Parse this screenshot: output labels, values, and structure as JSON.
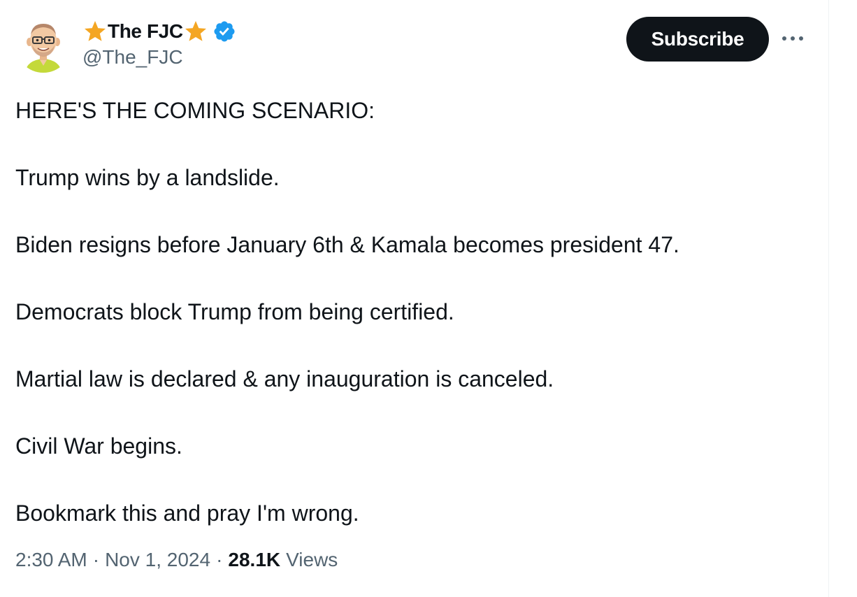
{
  "author": {
    "display_name": "The FJC",
    "handle": "@The_FJC",
    "name_decoration_icon": "star-icon",
    "verified_icon": "verified-badge-icon",
    "verified_color": "#1d9bf0"
  },
  "actions": {
    "subscribe_label": "Subscribe",
    "more_icon": "more-icon"
  },
  "tweet": {
    "lines": [
      "HERE'S THE COMING SCENARIO:",
      "Trump wins by a landslide.",
      "Biden resigns before January 6th & Kamala becomes president 47.",
      "Democrats block Trump from being certified.",
      "Martial law is declared & any inauguration is canceled.",
      "Civil War begins.",
      "Bookmark this and pray I'm wrong."
    ]
  },
  "meta": {
    "time": "2:30 AM",
    "separator": "·",
    "date": "Nov 1, 2024",
    "views_count": "28.1K",
    "views_label": "Views"
  },
  "colors": {
    "text_primary": "#0f1419",
    "text_secondary": "#536471",
    "button_bg": "#0f1419",
    "star": "#f4a623"
  }
}
